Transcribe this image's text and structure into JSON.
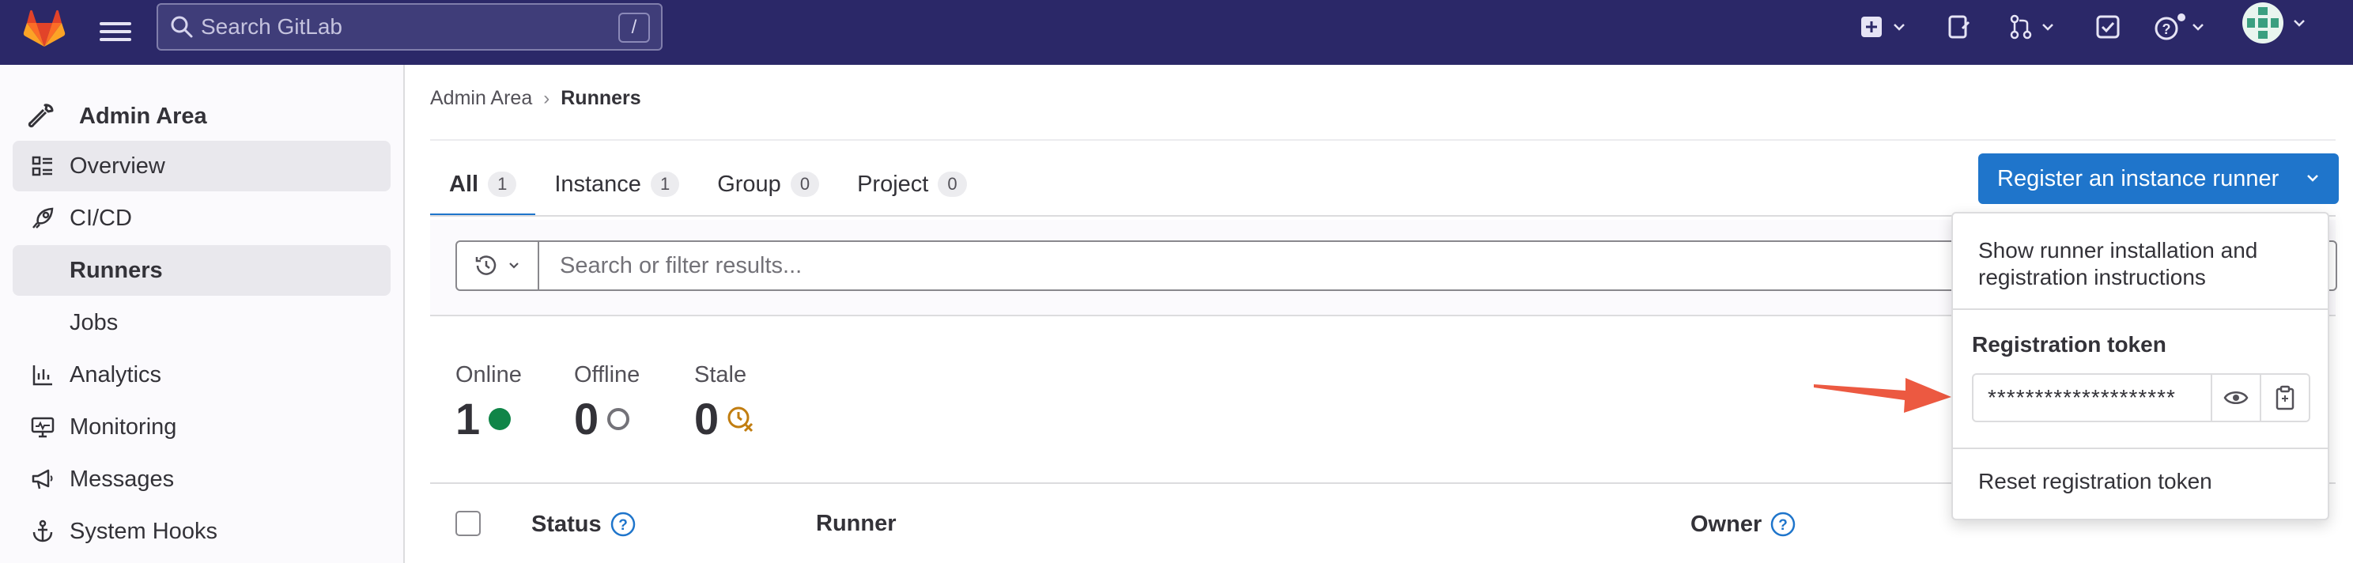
{
  "topbar": {
    "search_placeholder": "Search GitLab",
    "search_shortcut": "/"
  },
  "sidebar": {
    "header": "Admin Area",
    "items": [
      {
        "label": "Overview"
      },
      {
        "label": "CI/CD"
      },
      {
        "label": "Runners"
      },
      {
        "label": "Jobs"
      },
      {
        "label": "Analytics"
      },
      {
        "label": "Monitoring"
      },
      {
        "label": "Messages"
      },
      {
        "label": "System Hooks"
      }
    ]
  },
  "breadcrumb": {
    "parent": "Admin Area",
    "separator": "›",
    "current": "Runners"
  },
  "tabs": [
    {
      "label": "All",
      "count": "1"
    },
    {
      "label": "Instance",
      "count": "1"
    },
    {
      "label": "Group",
      "count": "0"
    },
    {
      "label": "Project",
      "count": "0"
    }
  ],
  "register_button": {
    "label": "Register an instance runner"
  },
  "filter": {
    "placeholder": "Search or filter results..."
  },
  "stats": [
    {
      "label": "Online",
      "value": "1"
    },
    {
      "label": "Offline",
      "value": "0"
    },
    {
      "label": "Stale",
      "value": "0"
    }
  ],
  "table": {
    "columns": {
      "status": "Status",
      "runner": "Runner",
      "owner": "Owner"
    }
  },
  "dropdown": {
    "show_instructions_line1": "Show runner installation and",
    "show_instructions_line2": "registration instructions",
    "token_title": "Registration token",
    "token_value": "********************",
    "reset_label": "Reset registration token"
  },
  "colors": {
    "topbar": "#2b2868",
    "primary": "#1f75cb",
    "online": "#108548",
    "stale": "#c17d10",
    "annotation_arrow": "#ec5941"
  }
}
